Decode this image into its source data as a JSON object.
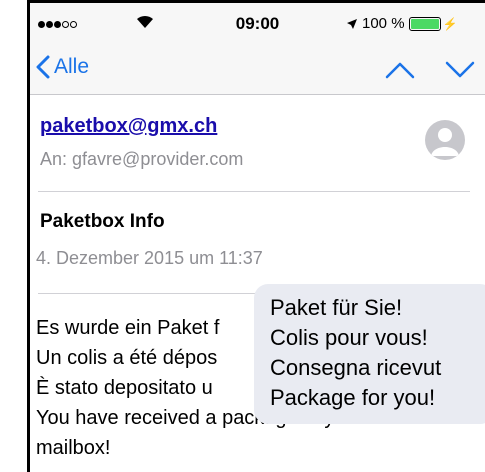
{
  "status": {
    "clock": "09:00",
    "battery_text": "100 %",
    "battery_level": 1.0
  },
  "nav": {
    "back_label": "Alle"
  },
  "message": {
    "sender": "paketbox@gmx.ch",
    "recipient": "An: gfavre@provider.com",
    "subject": "Paketbox Info",
    "date": "4. Dezember 2015 um 11:37",
    "body_lines": [
      "Es wurde ein Paket f",
      "Un colis a été dépos",
      "È stato depositato u",
      "You have received a package in your",
      "mailbox!"
    ]
  },
  "overlay": {
    "lines": [
      "Paket für Sie!",
      "Colis pour vous!",
      "Consegna ricevut",
      "Package for you!"
    ]
  },
  "colors": {
    "link": "#1a0dab",
    "ios_blue": "#1a73e8",
    "battery": "#4cd964"
  }
}
